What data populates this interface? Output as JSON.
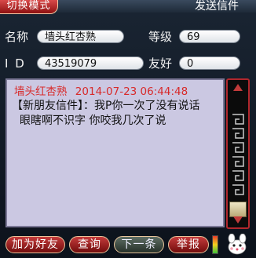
{
  "topbar": {
    "mode_tab": "切换模式",
    "send_title": "发送信件"
  },
  "profile": {
    "name_label": "名称",
    "name_value": "墙头红杏熟",
    "level_label": "等级",
    "level_value": "69",
    "id_label": "I D",
    "id_value": "43519079",
    "friendship_label": "友好",
    "friendship_value": "0"
  },
  "message": {
    "sender": "墙头红杏熟",
    "timestamp": "2014-07-23 06:44:48",
    "line1": "【新朋友信件】：我P你一次了没有说话",
    "line2": "眼瞎啊不识字  你咬我几次了说"
  },
  "buttons": {
    "add_friend": "加为好友",
    "query": "查询",
    "next": "下一条",
    "report": "举报"
  },
  "colors": {
    "accent_red": "#c43b3b",
    "panel_bg": "#cbc8e2",
    "timestamp_red": "#d82a2a"
  },
  "icons": [
    "signal-strength-icon",
    "pet-avatar-icon",
    "scroll-up-icon",
    "scroll-down-icon"
  ]
}
